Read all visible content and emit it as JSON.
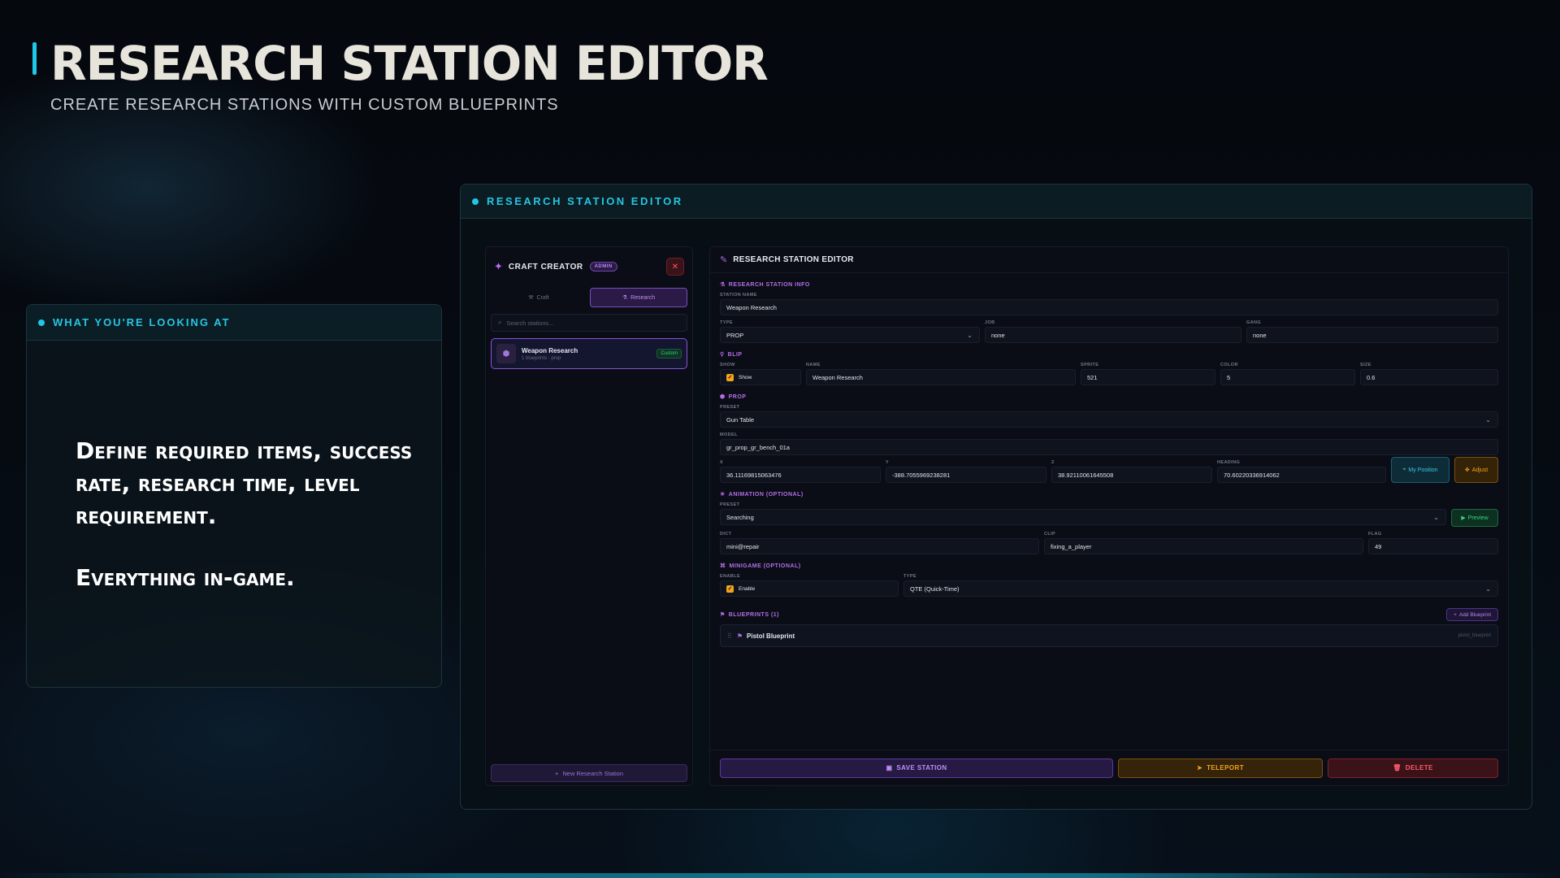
{
  "hero": {
    "title": "RESEARCH STATION EDITOR",
    "subtitle": "CREATE RESEARCH STATIONS WITH CUSTOM BLUEPRINTS"
  },
  "info_card": {
    "header": "WHAT YOU'RE LOOKING AT",
    "line1": "Define required items, success rate, research time, level requirement.",
    "line2": "Everything in-game."
  },
  "app": {
    "header": "RESEARCH STATION EDITOR"
  },
  "sidebar": {
    "title": "CRAFT CREATOR",
    "badge": "ADMIN",
    "close_glyph": "✕",
    "tabs": [
      {
        "label": "Craft",
        "active": false
      },
      {
        "label": "Research",
        "active": true
      }
    ],
    "search_placeholder": "Search stations...",
    "stations": [
      {
        "name": "Weapon Research",
        "meta": "1 blueprints · prop",
        "badge": "Custom"
      }
    ],
    "new_button": "New Research Station"
  },
  "editor": {
    "title": "RESEARCH STATION EDITOR",
    "info": {
      "section": "RESEARCH STATION INFO",
      "station_name_label": "STATION NAME",
      "station_name": "Weapon Research",
      "type_label": "TYPE",
      "type": "PROP",
      "job_label": "JOB",
      "job": "none",
      "gang_label": "GANG",
      "gang": "none"
    },
    "blip": {
      "section": "BLIP",
      "show_label": "SHOW",
      "show_text": "Show",
      "name_label": "NAME",
      "name": "Weapon Research",
      "sprite_label": "SPRITE",
      "sprite": "521",
      "color_label": "COLOR",
      "color": "5",
      "size_label": "SIZE",
      "size": "0.6"
    },
    "prop": {
      "section": "PROP",
      "preset_label": "PRESET",
      "preset": "Gun Table",
      "model_label": "MODEL",
      "model": "gr_prop_gr_bench_01a",
      "x_label": "X",
      "x": "36.11169815063476",
      "y_label": "Y",
      "y": "-388.7055969238281",
      "z_label": "Z",
      "z": "38.92110061645508",
      "heading_label": "HEADING",
      "heading": "70.60220336914062",
      "my_position": "My Position",
      "adjust": "Adjust"
    },
    "animation": {
      "section": "ANIMATION (OPTIONAL)",
      "preset_label": "PRESET",
      "preset": "Searching",
      "preview": "Preview",
      "dict_label": "DICT",
      "dict": "mini@repair",
      "clip_label": "CLIP",
      "clip": "fixing_a_player",
      "flag_label": "FLAG",
      "flag": "49"
    },
    "minigame": {
      "section": "MINIGAME (OPTIONAL)",
      "enable_label": "ENABLE",
      "enable_text": "Enable",
      "type_label": "TYPE",
      "type": "QTE (Quick-Time)"
    },
    "blueprints": {
      "section": "BLUEPRINTS (1)",
      "add_button": "Add Blueprint",
      "items": [
        {
          "name": "Pistol Blueprint",
          "id": "pistol_blueprint"
        }
      ]
    },
    "footer": {
      "save": "SAVE STATION",
      "teleport": "TELEPORT",
      "delete": "DELETE"
    }
  },
  "colors": {
    "accent_cyan": "#1ec8e6",
    "accent_purple": "#b56ee8",
    "accent_amber": "#f2a51c",
    "accent_red": "#ff5a6a",
    "accent_green": "#32d880"
  }
}
